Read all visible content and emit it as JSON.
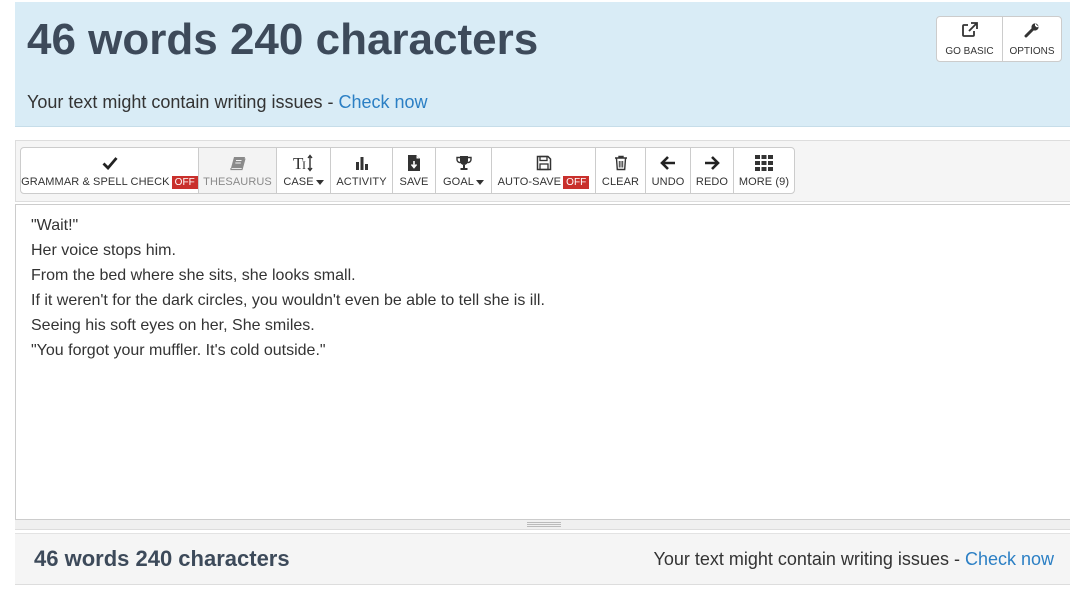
{
  "stats": {
    "title": "46 words 240 characters",
    "issues_text": "Your text might contain writing issues - ",
    "check_link": "Check now"
  },
  "top_buttons": {
    "go_basic": "GO BASIC",
    "options": "OPTIONS"
  },
  "toolbar": {
    "grammar": "GRAMMAR & SPELL CHECK",
    "grammar_state": "OFF",
    "thesaurus": "THESAURUS",
    "case": "CASE",
    "activity": "ACTIVITY",
    "save": "SAVE",
    "goal": "GOAL",
    "autosave": "AUTO-SAVE",
    "autosave_state": "OFF",
    "clear": "CLEAR",
    "undo": "UNDO",
    "redo": "REDO",
    "more": "MORE (9)"
  },
  "editor": {
    "lines": [
      "\"Wait!\"",
      "Her voice stops him.",
      "From the bed where she sits, she looks small.",
      "If it weren't for the dark circles, you wouldn't even be able to tell she is ill.",
      "Seeing his soft eyes on her, She smiles.",
      "\"You forgot your muffler. It's cold outside.\""
    ]
  },
  "bottom": {
    "stats": "46 words 240 characters",
    "issues_text": "Your text might contain writing issues - ",
    "check_link": "Check now"
  },
  "colors": {
    "panel_bg": "#d9ecf6",
    "title_text": "#3d4a5a",
    "link": "#2b7fc4",
    "off_badge": "#c9302c"
  }
}
